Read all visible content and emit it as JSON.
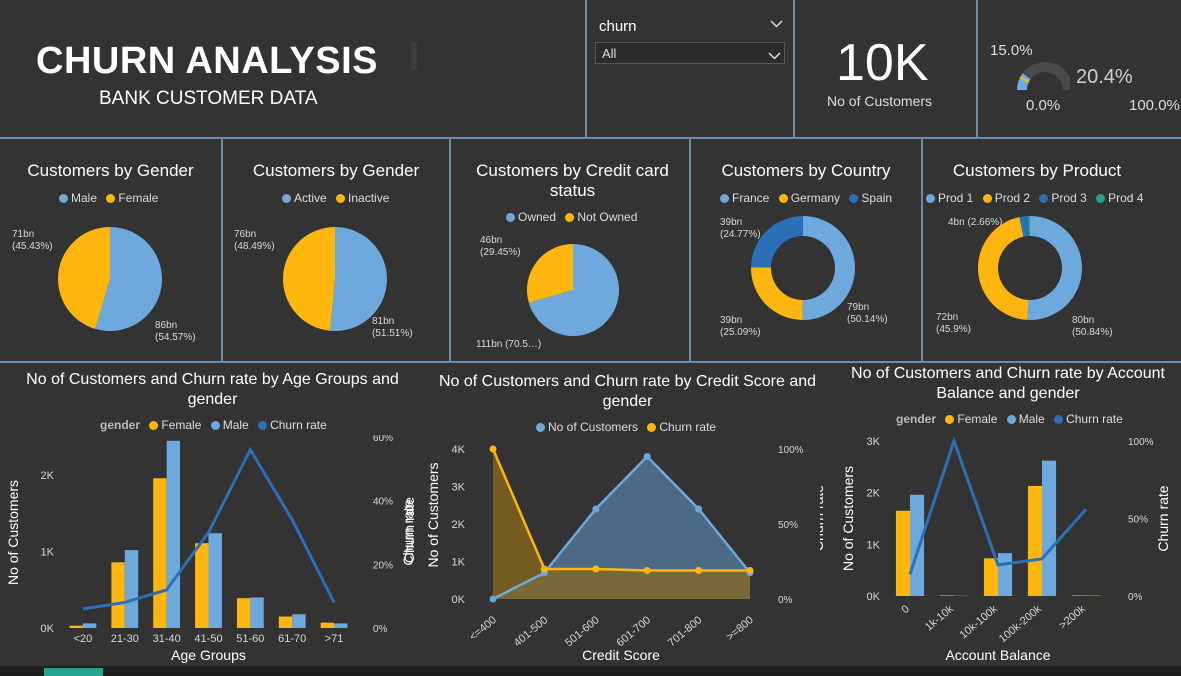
{
  "header": {
    "title": "CHURN ANALYSIS",
    "subtitle": "BANK CUSTOMER DATA"
  },
  "slicer": {
    "label": "churn",
    "value": "All"
  },
  "kpi": {
    "value": "10K",
    "label": "No of Customers"
  },
  "gauge": {
    "value_label": "20.4%",
    "target_label": "15.0%",
    "min_label": "0.0%",
    "max_label": "100.0%",
    "value": 20.4,
    "target": 15.0,
    "min": 0,
    "max": 100
  },
  "colors": {
    "female": "#FFB70F",
    "male": "#6EA9DD",
    "churn": "#2B6FB7",
    "teal": "#21A58E",
    "bg": "#333333"
  },
  "chart_data": [
    {
      "type": "pie",
      "title": "Customers by Gender",
      "legend": [
        "Male",
        "Female"
      ],
      "slices": [
        {
          "name": "Male",
          "value": 86,
          "percent": 54.57,
          "label": "86bn\n(54.57%)"
        },
        {
          "name": "Female",
          "value": 71,
          "percent": 45.43,
          "label": "71bn\n(45.43%)"
        }
      ]
    },
    {
      "type": "pie",
      "title": "Customers by Gender",
      "legend": [
        "Active",
        "Inactive"
      ],
      "slices": [
        {
          "name": "Active",
          "value": 81,
          "percent": 51.51,
          "label": "81bn\n(51.51%)"
        },
        {
          "name": "Inactive",
          "value": 76,
          "percent": 48.49,
          "label": "76bn\n(48.49%)"
        }
      ]
    },
    {
      "type": "pie",
      "title": "Customers by Credit card status",
      "legend": [
        "Owned",
        "Not Owned"
      ],
      "slices": [
        {
          "name": "Owned",
          "value": 111,
          "percent": 70.55,
          "label": "111bn (70.5…)"
        },
        {
          "name": "Not Owned",
          "value": 46,
          "percent": 29.45,
          "label": "46bn\n(29.45%)"
        }
      ]
    },
    {
      "type": "pie",
      "subtype": "donut",
      "title": "Customers by Country",
      "legend": [
        "France",
        "Germany",
        "Spain"
      ],
      "slices": [
        {
          "name": "France",
          "value": 79,
          "percent": 50.14,
          "label": "79bn\n(50.14%)"
        },
        {
          "name": "Germany",
          "value": 39,
          "percent": 25.09,
          "label": "39bn\n(25.09%)"
        },
        {
          "name": "Spain",
          "value": 39,
          "percent": 24.77,
          "label": "39bn\n(24.77%)"
        }
      ]
    },
    {
      "type": "pie",
      "subtype": "donut",
      "title": "Customers by Product",
      "legend": [
        "Prod 1",
        "Prod 2",
        "Prod 3",
        "Prod 4"
      ],
      "slices": [
        {
          "name": "Prod 1",
          "value": 80,
          "percent": 50.84,
          "label": "80bn\n(50.84%)"
        },
        {
          "name": "Prod 2",
          "value": 72,
          "percent": 45.9,
          "label": "72bn\n(45.9%)"
        },
        {
          "name": "Prod 3",
          "value": 4,
          "percent": 2.66,
          "label": "4bn (2.66%)"
        },
        {
          "name": "Prod 4",
          "value": 1,
          "percent": 0.6,
          "label": ""
        }
      ]
    },
    {
      "type": "bar",
      "title": "No of Customers and Churn rate by Age Groups and gender",
      "legend_title": "gender",
      "legend": [
        "Female",
        "Male",
        "Churn rate"
      ],
      "categories": [
        "<20",
        "21-30",
        "31-40",
        "41-50",
        "51-60",
        "61-70",
        ">71"
      ],
      "series": [
        {
          "name": "Female",
          "values": [
            30,
            860,
            1960,
            1110,
            390,
            150,
            70
          ]
        },
        {
          "name": "Male",
          "values": [
            60,
            1020,
            2450,
            1240,
            400,
            180,
            60
          ]
        },
        {
          "name": "Churn rate",
          "type": "line",
          "axis": "right",
          "values": [
            6,
            8,
            12,
            30,
            56,
            34,
            8
          ]
        }
      ],
      "xlabel": "Age Groups",
      "ylabel": "No of Customers",
      "y2label": "Churn rate",
      "ylim": [
        0,
        2500
      ],
      "yticks": [
        "0K",
        "1K",
        "2K"
      ],
      "y2lim": [
        0,
        60
      ],
      "y2ticks": [
        "0%",
        "20%",
        "40%",
        "60%"
      ]
    },
    {
      "type": "area",
      "title": "No of Customers and Churn rate by Credit Score and gender",
      "legend": [
        "No of Customers",
        "Churn rate"
      ],
      "categories": [
        "<=400",
        "401-500",
        "501-600",
        "601-700",
        "701-800",
        ">=800"
      ],
      "series": [
        {
          "name": "No of Customers",
          "values": [
            0,
            700,
            2400,
            3800,
            2400,
            700
          ]
        },
        {
          "name": "Churn rate",
          "axis": "right",
          "values": [
            100,
            20,
            20,
            19,
            19,
            19
          ]
        }
      ],
      "xlabel": "Credit Score",
      "ylabel": "No of Customers",
      "y2label": "Churn rate",
      "ylim": [
        0,
        4000
      ],
      "yticks": [
        "0K",
        "1K",
        "2K",
        "3K",
        "4K"
      ],
      "y2lim": [
        0,
        100
      ],
      "y2ticks": [
        "0%",
        "50%",
        "100%"
      ]
    },
    {
      "type": "bar",
      "title": "No of Customers and Churn rate by Account Balance and gender",
      "legend_title": "gender",
      "legend": [
        "Female",
        "Male",
        "Churn rate"
      ],
      "categories": [
        "0",
        "1k-10k",
        "10k-100k",
        "100k-200k",
        ">200k"
      ],
      "series": [
        {
          "name": "Female",
          "values": [
            1650,
            10,
            730,
            2130,
            10
          ]
        },
        {
          "name": "Male",
          "values": [
            1960,
            5,
            830,
            2620,
            10
          ]
        },
        {
          "name": "Churn rate",
          "type": "line",
          "axis": "right",
          "values": [
            14,
            100,
            20,
            24,
            56
          ]
        }
      ],
      "xlabel": "Account Balance",
      "ylabel": "No of Customers",
      "y2label": "Churn rate",
      "ylim": [
        0,
        3000
      ],
      "yticks": [
        "0K",
        "1K",
        "2K",
        "3K"
      ],
      "y2lim": [
        0,
        100
      ],
      "y2ticks": [
        "0%",
        "50%",
        "100%"
      ]
    }
  ]
}
